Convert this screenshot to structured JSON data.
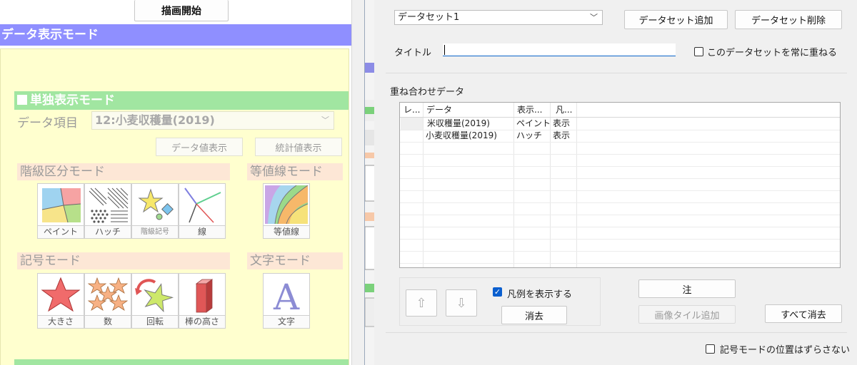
{
  "left": {
    "start_button": "描画開始",
    "mode_title": "データ表示モード",
    "single_mode_title": "単独表示モード",
    "data_item_label": "データ項目",
    "data_item_value": "12:小麦収穫量(2019)",
    "data_value_button": "データ値表示",
    "stat_value_button": "統計値表示",
    "class_mode_title": "階級区分モード",
    "iso_mode_title": "等値線モード",
    "class_tiles": [
      "ペイント",
      "ハッチ",
      "階級記号",
      "線"
    ],
    "iso_tiles": [
      "等値線"
    ],
    "symbol_mode_title": "記号モード",
    "text_mode_title": "文字モード",
    "symbol_tiles": [
      "大きさ",
      "数",
      "回転",
      "棒の高さ"
    ],
    "text_tiles": [
      "文字"
    ]
  },
  "right": {
    "dataset_select": "データセット1",
    "add_dataset_button": "データセット追加",
    "delete_dataset_button": "データセット削除",
    "title_label": "タイトル",
    "title_value": "",
    "overlay_always_label": "このデータセットを常に重ねる",
    "overlay_always_checked": false,
    "overlap_section_title": "重ね合わせデータ",
    "table": {
      "columns": [
        "レ...",
        "データ",
        "表示...",
        "凡..."
      ],
      "rows": [
        [
          "",
          "米収穫量(2019)",
          "ペイント",
          "表示"
        ],
        [
          "",
          "小麦収穫量(2019)",
          "ハッチ",
          "表示"
        ]
      ]
    },
    "up_arrow": "⇧",
    "down_arrow": "⇩",
    "show_legend_label": "凡例を表示する",
    "show_legend_checked": true,
    "clear_button": "消去",
    "note_button": "注",
    "add_image_tile_button": "画像タイル追加",
    "clear_all_button": "すべて消去",
    "fix_symbol_position_label": "記号モードの位置はずらさない",
    "fix_symbol_position_checked": false
  },
  "colors": {
    "mode_bar": "#8f8fff",
    "section_green": "#a1e6a1",
    "panel_yellow": "#ffffcf",
    "section_peach": "#fde7d6",
    "accent_blue": "#0b5fcf"
  }
}
